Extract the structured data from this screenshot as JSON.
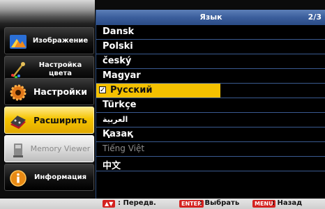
{
  "sidebar": {
    "items": [
      {
        "label": "Изображение",
        "icon": "image-icon"
      },
      {
        "label": "Настройка цвета",
        "icon": "color-adjust-icon"
      },
      {
        "label": "Настройки",
        "icon": "settings-icon"
      },
      {
        "label": "Расширить",
        "icon": "expand-icon"
      },
      {
        "label": "Memory Viewer",
        "icon": "memory-card-icon"
      },
      {
        "label": "Информация",
        "icon": "info-icon"
      }
    ]
  },
  "panel": {
    "title": "Язык",
    "page": "2/3",
    "selected_index": 4,
    "check_symbol": "✓",
    "languages": [
      "Dansk",
      "Polski",
      "český",
      "Magyar",
      "Русский",
      "Türkçe",
      "العربية",
      "Қазақ",
      "Tiếng Việt",
      "中文"
    ]
  },
  "footer": {
    "move_key": "▲▼",
    "move_label": ": Передв.",
    "enter_key": "ENTER",
    "enter_label": ": Выбрать",
    "menu_key": "MENU",
    "menu_label": ": Назад"
  },
  "colors": {
    "accent": "#f4c100",
    "header": "#3b5e9c",
    "row_divider": "#3a5a90",
    "key_badge": "#d4211f"
  }
}
